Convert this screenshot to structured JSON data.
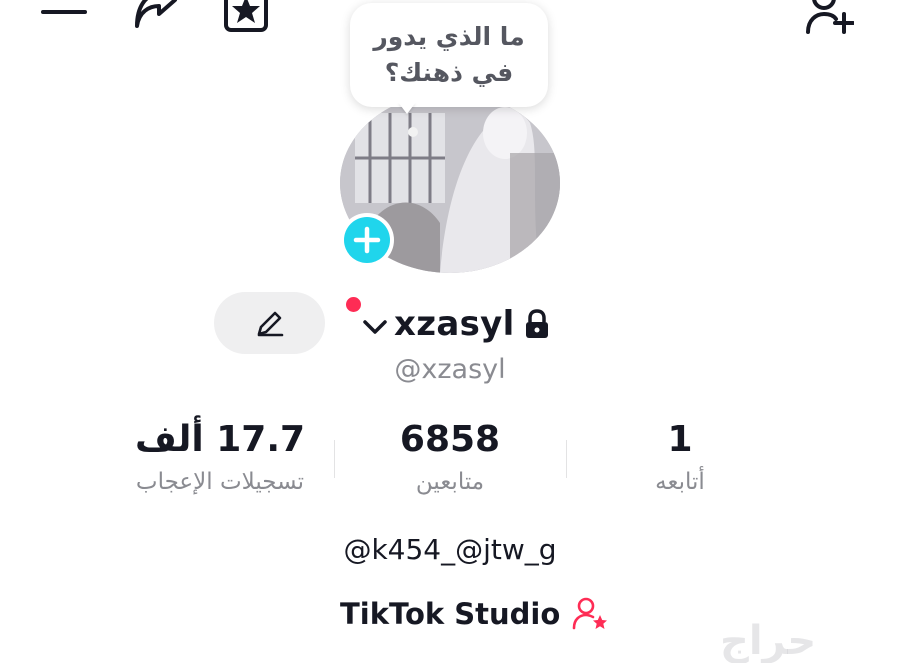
{
  "top_bar": {
    "icons": [
      "menu-icon",
      "share-arrow-icon",
      "favorites-star-icon",
      "add-friend-icon"
    ]
  },
  "bubble": {
    "line1": "ما الذي يدور",
    "line2": "في ذهنك؟"
  },
  "profile": {
    "username": "xzasyl",
    "handle": "@xzasyl",
    "bio": "@k454_@jtw_g",
    "accent_color": "#20d5ec",
    "notification_color": "#fe2c55"
  },
  "stats": {
    "likes": {
      "value": "17.7 ألف",
      "label": "تسجيلات الإعجاب"
    },
    "followers": {
      "value": "6858",
      "label": "متابعين"
    },
    "following": {
      "value": "1",
      "label": "أتابعه"
    }
  },
  "studio": {
    "label": "TikTok Studio",
    "icon": "user-star-icon"
  },
  "watermark": {
    "text": "حراج"
  }
}
